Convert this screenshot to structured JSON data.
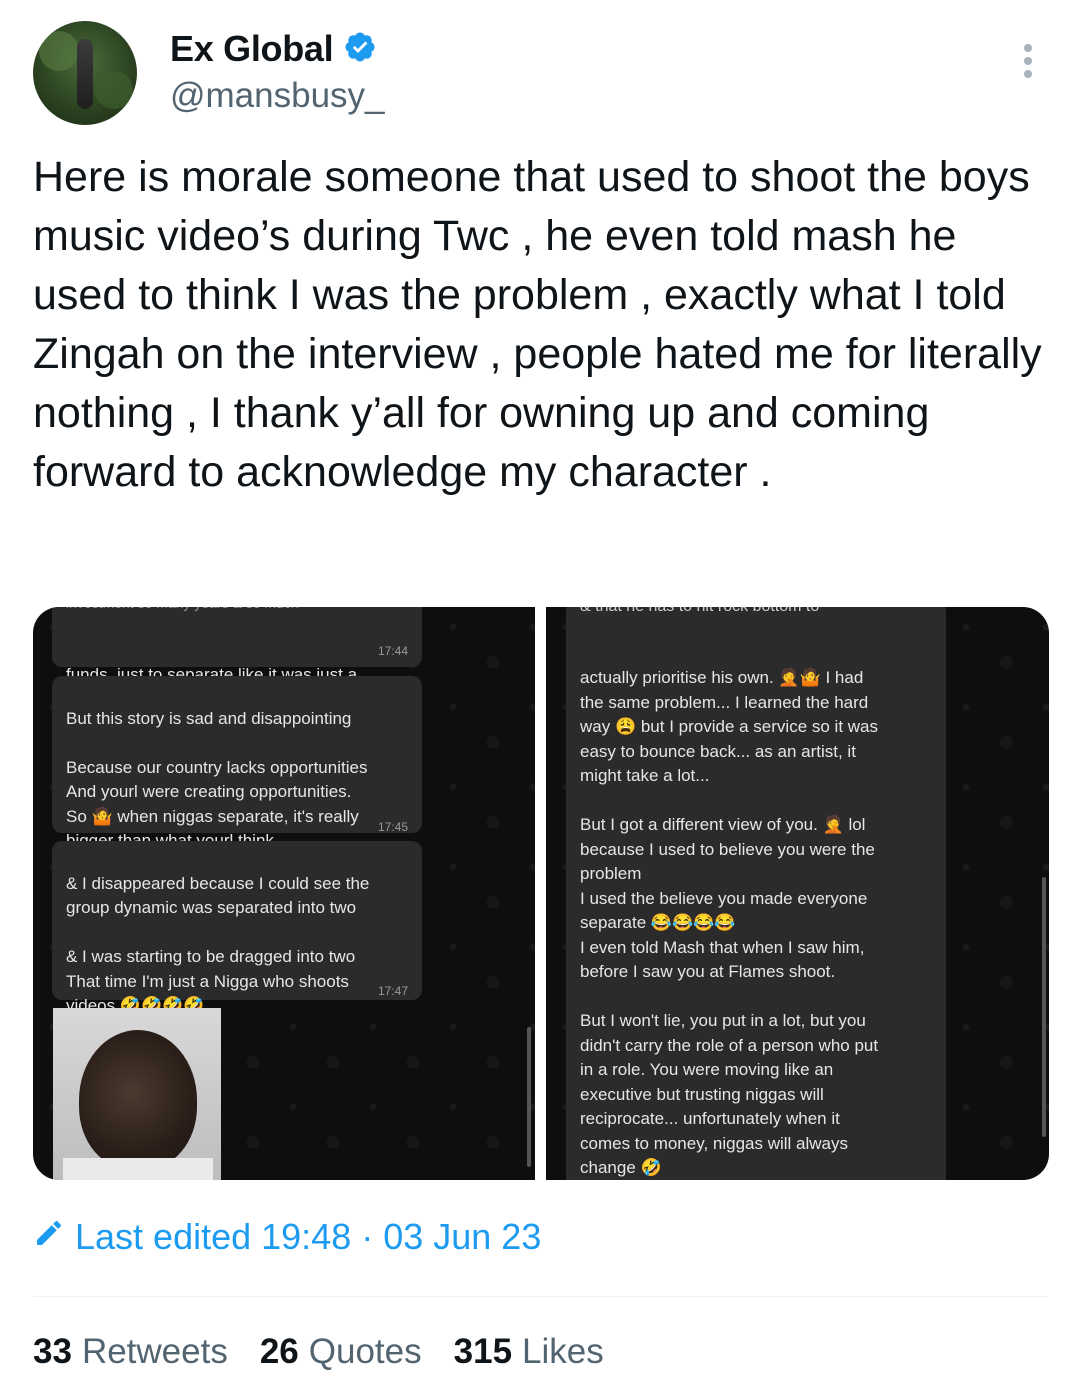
{
  "author": {
    "name": "Ex Global",
    "handle": "@mansbusy_",
    "verified_color": "#1d9bf0"
  },
  "tweet": {
    "text": "Here is morale someone that used to shoot the boys music video’s during Twc , he even told mash he used to think I was the problem , exactly what I told Zingah on the interview , people hated me for literally nothing , I thank y’all for owning up and coming forward to acknowledge my character ."
  },
  "screenshots": {
    "left": {
      "messages": [
        {
          "text": "funds, just to separate like it was just a\nfriendship...",
          "time": "17:44"
        },
        {
          "text": "But this story is sad and disappointing\n\nBecause our country lacks opportunities\nAnd yourl were creating opportunities.\nSo 🤷 when niggas separate, it's really\nbigger than what yourl think.",
          "time": "17:45"
        },
        {
          "text": "& I disappeared because I could see the\ngroup dynamic was separated into two\n\n& I was starting to be dragged into two\nThat time I'm just a Nigga who shoots\nvideos 🤣🤣🤣🤣",
          "time": "17:47"
        }
      ],
      "cut_top_text": "investment so many years & so much"
    },
    "right": {
      "cut_top_text": "& that he has to hit rock bottom to",
      "message": "actually prioritise his own. 🤦🤷 I had\nthe same problem... I learned the hard\nway 😩 but I provide a service so it was\neasy to bounce back... as an artist, it\nmight take a lot...\n\nBut I got a different view of you. 🤦 lol\nbecause I used to believe you were the\nproblem\nI used the believe you made everyone\nseparate 😂😂😂😂\nI even told Mash that when I saw him,\nbefore I saw you at Flames shoot.\n\nBut I won't lie, you put in a lot, but you\ndidn't carry the role of a person who put\nin a role. You were moving like an\nexecutive but trusting niggas will\nreciprocate... unfortunately when it\ncomes to money, niggas will always\nchange 🤣\nSo you have to just want your percentage\nfrom the jump, even if they think you"
    }
  },
  "meta": {
    "edited_label": "Last edited 19:48 · 03 Jun 23"
  },
  "stats": {
    "retweets_count": "33",
    "retweets_label": "Retweets",
    "quotes_count": "26",
    "quotes_label": "Quotes",
    "likes_count": "315",
    "likes_label": "Likes"
  }
}
